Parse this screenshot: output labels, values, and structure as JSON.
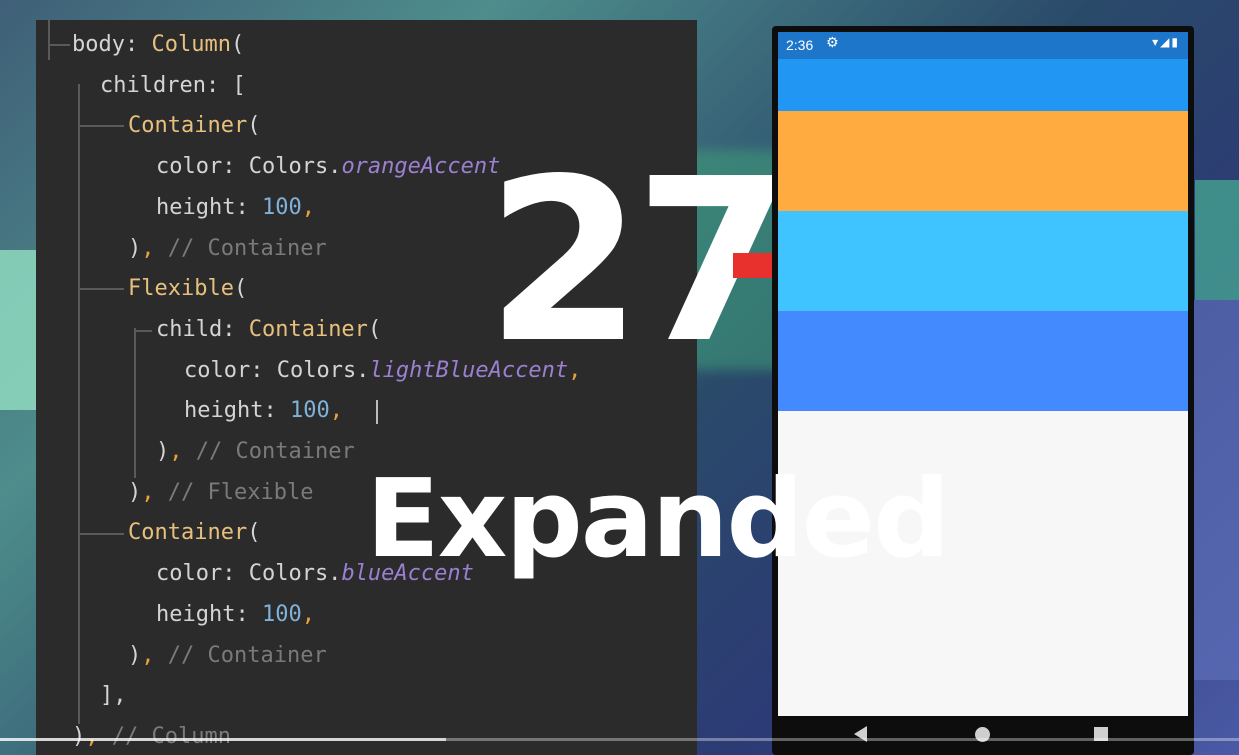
{
  "code": {
    "lines": [
      [
        {
          "t": "body: ",
          "c": "kw"
        },
        {
          "t": "Column",
          "c": "fn"
        },
        {
          "t": "(",
          "c": "kw"
        }
      ],
      [
        {
          "t": "children: [",
          "c": "kw"
        }
      ],
      [
        {
          "t": "Container",
          "c": "fn"
        },
        {
          "t": "(",
          "c": "kw"
        }
      ],
      [
        {
          "t": "color: Colors.",
          "c": "kw"
        },
        {
          "t": "orangeAccent",
          "c": "prop"
        }
      ],
      [
        {
          "t": "height: ",
          "c": "kw"
        },
        {
          "t": "100",
          "c": "num"
        },
        {
          "t": ",",
          "c": "punct"
        }
      ],
      [
        {
          "t": ")",
          "c": "kw"
        },
        {
          "t": ", ",
          "c": "punct"
        },
        {
          "t": "// Container",
          "c": "comment"
        }
      ],
      [
        {
          "t": "Flexible",
          "c": "fn"
        },
        {
          "t": "(",
          "c": "kw"
        }
      ],
      [
        {
          "t": "child: ",
          "c": "kw"
        },
        {
          "t": "Container",
          "c": "fn"
        },
        {
          "t": "(",
          "c": "kw"
        }
      ],
      [
        {
          "t": "color: Colors.",
          "c": "kw"
        },
        {
          "t": "lightBlueAccent",
          "c": "prop"
        },
        {
          "t": ",",
          "c": "punct"
        }
      ],
      [
        {
          "t": "height: ",
          "c": "kw"
        },
        {
          "t": "100",
          "c": "num"
        },
        {
          "t": ",",
          "c": "punct"
        }
      ],
      [
        {
          "t": ")",
          "c": "kw"
        },
        {
          "t": ", ",
          "c": "punct"
        },
        {
          "t": "// Container",
          "c": "comment"
        }
      ],
      [
        {
          "t": ")",
          "c": "kw"
        },
        {
          "t": ", ",
          "c": "punct"
        },
        {
          "t": "// Flexible",
          "c": "comment"
        }
      ],
      [
        {
          "t": "Container",
          "c": "fn"
        },
        {
          "t": "(",
          "c": "kw"
        }
      ],
      [
        {
          "t": "color: Colors.",
          "c": "kw"
        },
        {
          "t": "blueAccent",
          "c": "prop"
        }
      ],
      [
        {
          "t": "height: ",
          "c": "kw"
        },
        {
          "t": "100",
          "c": "num"
        },
        {
          "t": ",",
          "c": "punct"
        }
      ],
      [
        {
          "t": ")",
          "c": "kw"
        },
        {
          "t": ", ",
          "c": "punct"
        },
        {
          "t": "// Container",
          "c": "comment"
        }
      ],
      [
        {
          "t": "],",
          "c": "kw"
        }
      ],
      [
        {
          "t": ")",
          "c": "kw"
        },
        {
          "t": ", ",
          "c": "punct"
        },
        {
          "t": "// Column",
          "c": "comment"
        }
      ]
    ]
  },
  "overlay": {
    "number": "27",
    "word": "Expanded"
  },
  "phone": {
    "status_time": "2:36",
    "status_gear": "⚙",
    "status_icons": "▾◢▮",
    "colors": {
      "app_bar": "#2196f3",
      "orange_accent": "#ffab40",
      "light_blue_accent": "#40c4ff",
      "blue_accent": "#448aff"
    }
  },
  "video": {
    "progress": 0.36
  }
}
